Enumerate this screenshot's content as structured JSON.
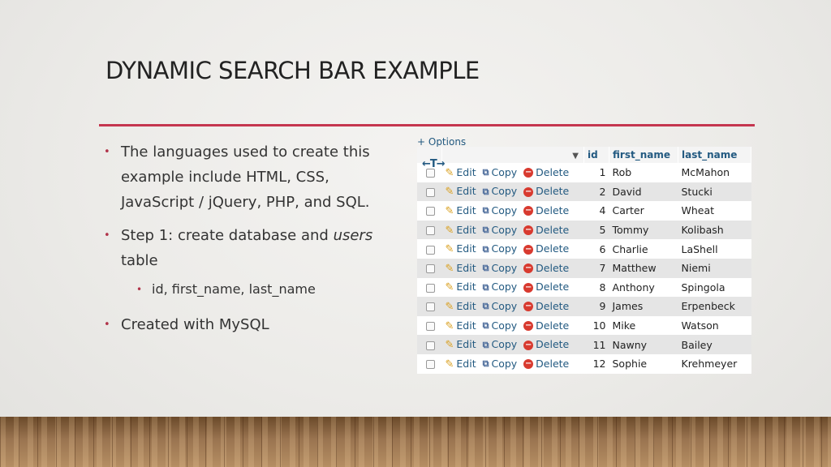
{
  "slide": {
    "title": "DYNAMIC SEARCH BAR EXAMPLE",
    "bullets": {
      "b1_line1": "The languages used to create this",
      "b1_line2": "example include HTML, CSS,",
      "b1_line3": "JavaScript / jQuery, PHP, and SQL.",
      "b2_pre": "Step 1: create database and ",
      "b2_em": "users",
      "b2_post": "table",
      "b2_sub": "id, first_name, last_name",
      "b3": "Created with MySQL"
    },
    "accent_color": "#c5364f"
  },
  "table": {
    "options_label": "+ Options",
    "nav_arrows": "←T→",
    "sort_arrow": "▼",
    "headers": [
      "id",
      "first_name",
      "last_name"
    ],
    "action_labels": {
      "edit": "Edit",
      "copy": "Copy",
      "delete": "Delete"
    },
    "action_icons": {
      "edit": "pencil-icon",
      "copy": "copy-icon",
      "delete": "delete-icon"
    },
    "rows": [
      {
        "id": "1",
        "first_name": "Rob",
        "last_name": "McMahon"
      },
      {
        "id": "2",
        "first_name": "David",
        "last_name": "Stucki"
      },
      {
        "id": "4",
        "first_name": "Carter",
        "last_name": "Wheat"
      },
      {
        "id": "5",
        "first_name": "Tommy",
        "last_name": "Kolibash"
      },
      {
        "id": "6",
        "first_name": "Charlie",
        "last_name": "LaShell"
      },
      {
        "id": "7",
        "first_name": "Matthew",
        "last_name": "Niemi"
      },
      {
        "id": "8",
        "first_name": "Anthony",
        "last_name": "Spingola"
      },
      {
        "id": "9",
        "first_name": "James",
        "last_name": "Erpenbeck"
      },
      {
        "id": "10",
        "first_name": "Mike",
        "last_name": "Watson"
      },
      {
        "id": "11",
        "first_name": "Nawny",
        "last_name": "Bailey"
      },
      {
        "id": "12",
        "first_name": "Sophie",
        "last_name": "Krehmeyer"
      }
    ]
  }
}
